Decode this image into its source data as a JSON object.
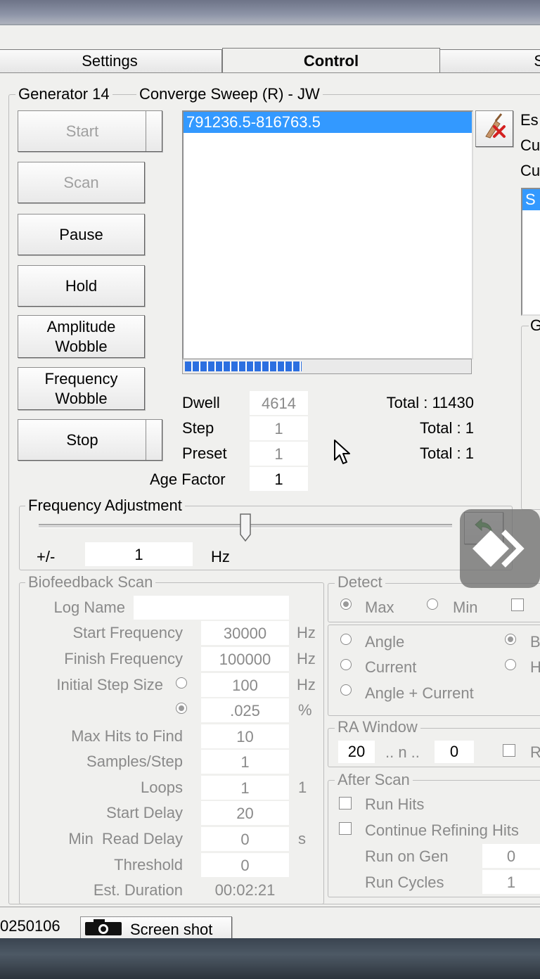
{
  "tabs": [
    "Settings",
    "Control",
    "Sy"
  ],
  "generator": {
    "label": "Generator 14",
    "program": "Converge Sweep (R) - JW"
  },
  "buttons": {
    "start": "Start",
    "scan": "Scan",
    "pause": "Pause",
    "hold": "Hold",
    "amplitude_wobble_1": "Amplitude",
    "amplitude_wobble_2": "Wobble",
    "frequency_wobble_1": "Frequency",
    "frequency_wobble_2": "Wobble",
    "stop": "Stop"
  },
  "program_list": {
    "selected": "791236.5-816763.5",
    "progress_fraction": 0.41
  },
  "right_panel": {
    "label1": "Es",
    "label2": "Cu",
    "label3": "Cu",
    "list_selected": "S",
    "group_label": "G"
  },
  "counters": {
    "dwell_label": "Dwell",
    "dwell": "4614",
    "step_label": "Step",
    "step": "1",
    "preset_label": "Preset",
    "preset": "1",
    "age_label": "Age Factor",
    "age": "1",
    "total1": "Total : 11430",
    "total2": "Total : 1",
    "total3": "Total : 1"
  },
  "freq_adjust": {
    "legend": "Frequency Adjustment",
    "pm": "+/-",
    "value": "1",
    "unit": "Hz",
    "slider_fraction": 0.5
  },
  "biofeedback": {
    "legend": "Biofeedback Scan",
    "log_name_label": "Log Name",
    "log_name": "",
    "start_freq_label": "Start Frequency",
    "start_freq": "30000",
    "start_unit": "Hz",
    "finish_freq_label": "Finish Frequency",
    "finish_freq": "100000",
    "finish_unit": "Hz",
    "init_step_label": "Initial Step Size",
    "init_step_hz": "100",
    "step_hz_unit": "Hz",
    "init_step_pct": ".025",
    "step_pct_unit": "%",
    "max_hits_label": "Max Hits to Find",
    "max_hits": "10",
    "samples_label": "Samples/Step",
    "samples": "1",
    "loops_label": "Loops",
    "loops": "1",
    "loops_extra": "1",
    "start_delay_label": "Start Delay",
    "start_delay": "20",
    "min_read_label": "Min  Read Delay",
    "min_read": "0",
    "min_read_unit": "s",
    "threshold_label": "Threshold",
    "threshold": "0",
    "est_label": "Est. Duration",
    "est": "00:02:21"
  },
  "detect": {
    "legend": "Detect",
    "max": "Max",
    "min": "Min",
    "angle": "Angle",
    "current": "Current",
    "angle_current": "Angle + Current",
    "right1": "B",
    "right2": "H"
  },
  "ra_window": {
    "legend": "RA Window",
    "from": "20",
    "sep": ".. n ..",
    "to": "0",
    "check_label": "R"
  },
  "after_scan": {
    "legend": "After Scan",
    "run_hits": "Run Hits",
    "continue_refining": "Continue Refining Hits",
    "run_on_gen_label": "Run on Gen",
    "run_on_gen": "0",
    "run_cycles_label": "Run Cycles",
    "run_cycles": "1"
  },
  "status": {
    "left": "0250106",
    "screenshot": "Screen shot"
  }
}
